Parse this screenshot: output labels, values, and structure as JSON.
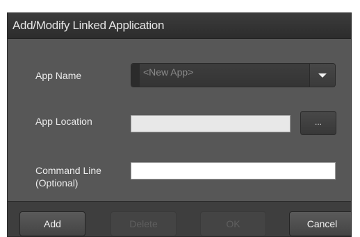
{
  "dialog": {
    "title": "Add/Modify Linked Application"
  },
  "form": {
    "app_name": {
      "label": "App Name",
      "selected_value": "<New App>"
    },
    "app_location": {
      "label": "App Location",
      "value": "",
      "browse_label": "..."
    },
    "command_line": {
      "label_line1": "Command Line",
      "label_line2": "(Optional)",
      "value": ""
    }
  },
  "buttons": {
    "add": "Add",
    "delete": "Delete",
    "ok": "OK",
    "cancel": "Cancel"
  },
  "colors": {
    "dialog_bg": "#575757",
    "titlebar_bg": "#333333",
    "footer_bg": "#3e3e3e",
    "disabled_text": "#5f5f5f"
  }
}
